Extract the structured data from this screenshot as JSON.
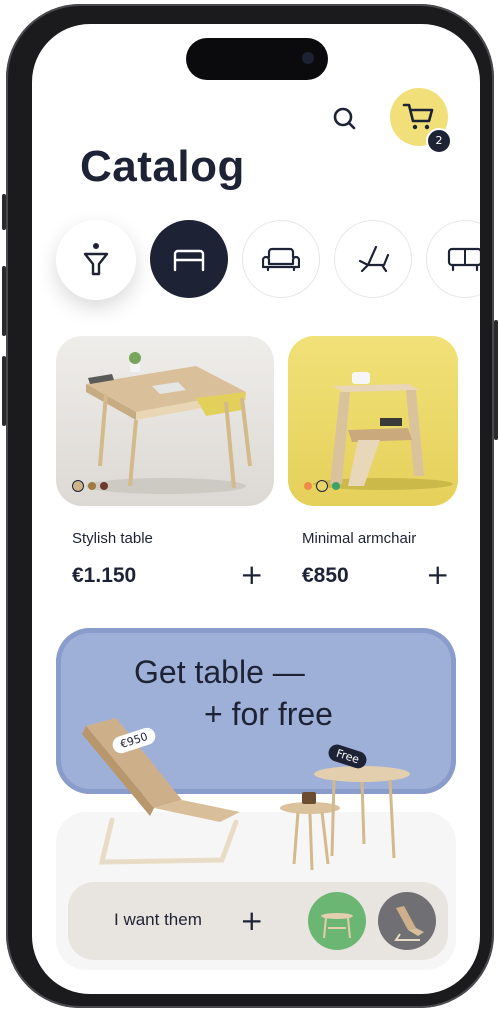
{
  "header": {
    "cart_count": "2"
  },
  "page": {
    "title": "Catalog"
  },
  "categories": [
    {
      "name": "filter",
      "icon": "filter-icon"
    },
    {
      "name": "beds",
      "icon": "bed-icon",
      "active": true
    },
    {
      "name": "sofas",
      "icon": "sofa-icon"
    },
    {
      "name": "chairs",
      "icon": "lounge-chair-icon"
    },
    {
      "name": "cabinets",
      "icon": "cabinet-icon"
    }
  ],
  "products": [
    {
      "name": "Stylish table",
      "price": "€1.150"
    },
    {
      "name": "Minimal armchair",
      "price": "€850"
    }
  ],
  "promo": {
    "line1": "Get table —",
    "line2": "+ for free",
    "price_tag": "€950",
    "free_tag": "Free",
    "cta_label": "I want them"
  },
  "colors": {
    "accent_yellow": "#f1e07a",
    "navy": "#1e2235",
    "promo_blue": "#9fb0d8",
    "thumb_green": "#6bb673"
  }
}
